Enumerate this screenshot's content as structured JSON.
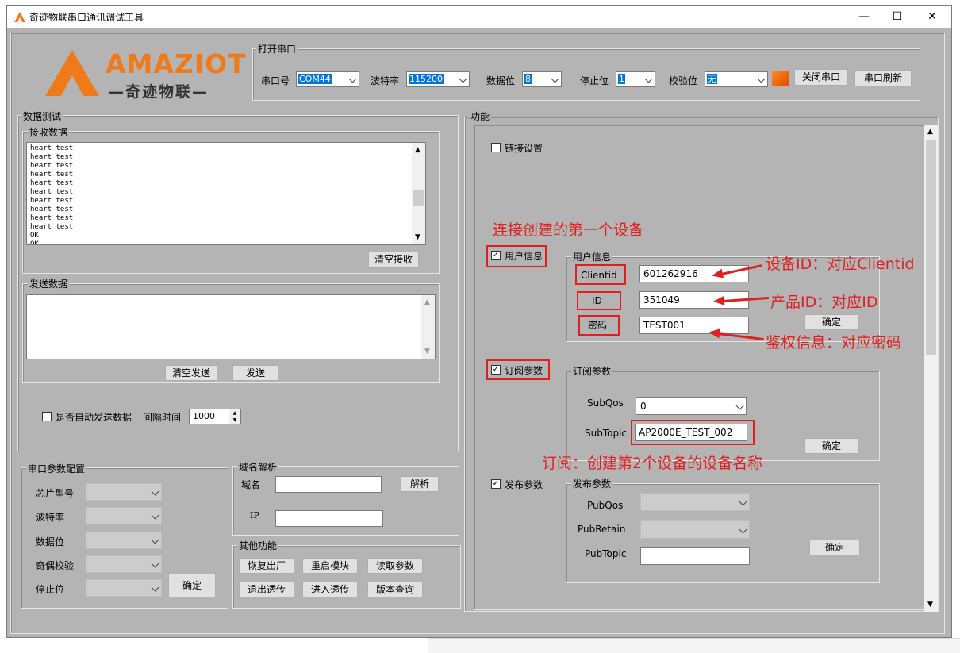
{
  "window": {
    "title": "奇迹物联串口通讯调试工具",
    "logo_text": "AMAZIOT",
    "logo_sub": "—奇迹物联—"
  },
  "serial_open": {
    "group": "打开串口",
    "port_label": "串口号",
    "port_value": "COM44",
    "baud_label": "波特率",
    "baud_value": "115200",
    "databits_label": "数据位",
    "databits_value": "8",
    "stopbits_label": "停止位",
    "stopbits_value": "1",
    "parity_label": "校验位",
    "parity_value": "无",
    "close_btn": "关闭串口",
    "refresh_btn": "串口刷新",
    "status_color": "#ff6600"
  },
  "data_test": {
    "group": "数据测试",
    "recv_group": "接收数据",
    "recv_lines": [
      "heart test",
      "heart test",
      "heart test",
      "heart test",
      "heart test",
      "heart test",
      "heart test",
      "heart test",
      "heart test",
      "heart test",
      "OK",
      "OK"
    ],
    "clear_recv": "清空接收",
    "send_group": "发送数据",
    "clear_send": "清空发送",
    "send_btn": "发送",
    "auto_send_label": "是否自动发送数据",
    "interval_label": "间隔时间",
    "interval_value": "1000"
  },
  "serial_config": {
    "group": "串口参数配置",
    "chip_label": "芯片型号",
    "baud_label": "波特率",
    "databits_label": "数据位",
    "parity_label": "奇偶校验",
    "stopbits_label": "停止位",
    "ok_btn": "确定"
  },
  "dns": {
    "group": "域名解析",
    "domain_label": "域名",
    "ip_label": "IP",
    "resolve_btn": "解析"
  },
  "other": {
    "group": "其他功能",
    "factory_btn": "恢复出厂",
    "reboot_btn": "重启模块",
    "read_btn": "读取参数",
    "exit_pass_btn": "退出透传",
    "enter_pass_btn": "进入透传",
    "version_btn": "版本查询"
  },
  "func": {
    "group": "功能",
    "link_label": "链接设置",
    "user_label": "用户信息",
    "user_group": "用户信息",
    "clientid_label": "Clientid",
    "clientid_value": "601262916",
    "id_label": "ID",
    "id_value": "351049",
    "pwd_label": "密码",
    "pwd_value": "TEST001",
    "user_ok": "确定",
    "sub_label": "订阅参数",
    "sub_group": "订阅参数",
    "subqos_label": "SubQos",
    "subqos_value": "0",
    "subtopic_label": "SubTopic",
    "subtopic_value": "AP2000E_TEST_002",
    "sub_ok": "确定",
    "pub_label": "发布参数",
    "pub_group": "发布参数",
    "pubqos_label": "PubQos",
    "pubretain_label": "PubRetain",
    "pubtopic_label": "PubTopic",
    "pub_ok": "确定"
  },
  "annotations": {
    "connect_first": "连接创建的第一个设备",
    "device_id": "设备ID：对应Clientid",
    "product_id": "产品ID：对应ID",
    "auth": "鉴权信息：对应密码",
    "subscribe": "订阅：创建第2个设备的设备名称",
    "color": "#e02020"
  }
}
